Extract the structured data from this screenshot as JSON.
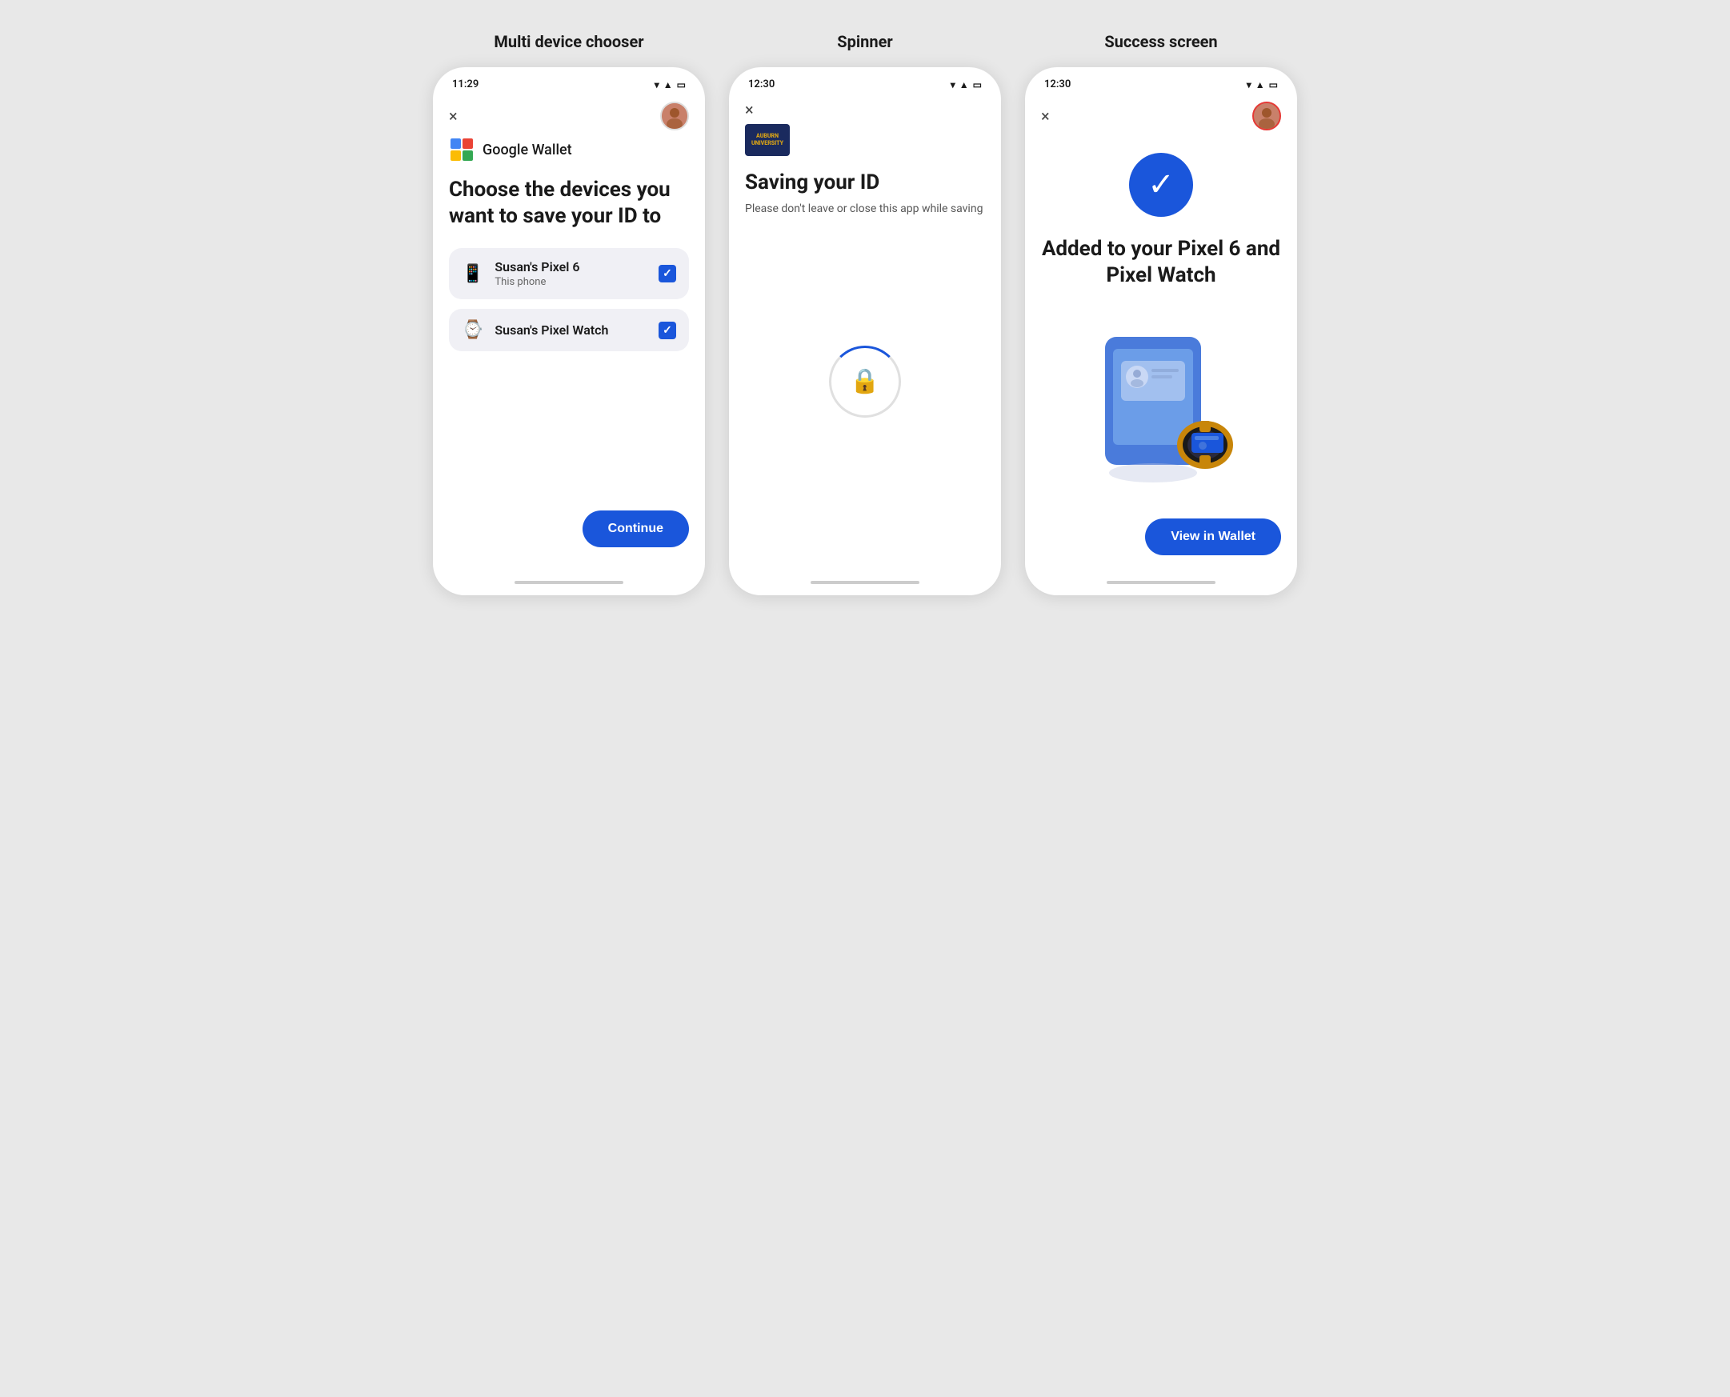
{
  "page": {
    "background": "#e8e8e8"
  },
  "screen1": {
    "title": "Multi device chooser",
    "status_time": "11:29",
    "close_label": "×",
    "wallet_logo": "Google Wallet",
    "choose_title": "Choose the devices you want to save your ID to",
    "device1_name": "Susan's Pixel 6",
    "device1_sub": "This phone",
    "device2_name": "Susan's Pixel Watch",
    "continue_label": "Continue"
  },
  "screen2": {
    "title": "Spinner",
    "status_time": "12:30",
    "close_label": "×",
    "school_name": "AUBURN\nUNIVERSITY",
    "saving_title": "Saving your ID",
    "saving_sub": "Please don't leave or close this app while saving"
  },
  "screen3": {
    "title": "Success screen",
    "status_time": "12:30",
    "close_label": "×",
    "success_title": "Added to your Pixel 6 and Pixel Watch",
    "view_wallet_label": "View in Wallet"
  }
}
